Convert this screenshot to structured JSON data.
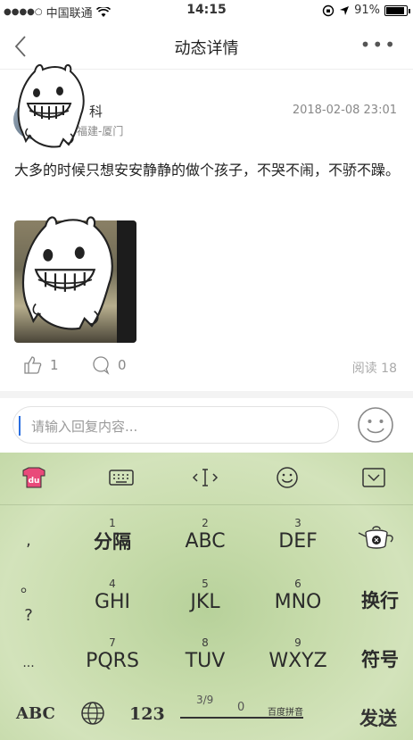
{
  "status_bar": {
    "carrier": "中国联通",
    "signal_dots": "●●●●○",
    "time": "14:15",
    "battery": "91%",
    "battery_level": 0.91
  },
  "nav": {
    "title": "动态详情",
    "more": "•••"
  },
  "post": {
    "username_partial": "科",
    "location": "福建-厦门",
    "timestamp": "2018-02-08 23:01",
    "text": "大多的时候只想安安静静的做个孩子，不哭不闹，不骄不躁。",
    "likes": "1",
    "comments": "0",
    "read_count": "阅读 18"
  },
  "reply": {
    "placeholder": "请输入回复内容..."
  },
  "keyboard": {
    "keys": [
      {
        "num": "1",
        "label": "分隔"
      },
      {
        "num": "2",
        "label": "ABC"
      },
      {
        "num": "3",
        "label": "DEF"
      },
      {
        "num": "4",
        "label": "GHI"
      },
      {
        "num": "5",
        "label": "JKL"
      },
      {
        "num": "6",
        "label": "MNO"
      },
      {
        "num": "7",
        "label": "PQRS"
      },
      {
        "num": "8",
        "label": "TUV"
      },
      {
        "num": "9",
        "label": "WXYZ"
      }
    ],
    "punctuation": [
      ",",
      "。",
      "?",
      "..."
    ],
    "side": {
      "newline": "换行",
      "symbols": "符号"
    },
    "bottom": {
      "abc": "ABC",
      "num": "123",
      "space_page": "3/9",
      "space_zero": "0",
      "space_name": "百度拼音",
      "send": "发送"
    },
    "colors": {
      "accent": "#2a6ee0",
      "keyboard_bg": "#c8dcac"
    }
  },
  "icons": [
    "back-icon",
    "more-icon",
    "like-icon",
    "comment-icon",
    "emoji-icon",
    "skin-icon",
    "keyboard-icon",
    "cursor-icon",
    "smiley-icon",
    "collapse-icon",
    "teapot-icon",
    "globe-icon",
    "sticker-icon"
  ]
}
